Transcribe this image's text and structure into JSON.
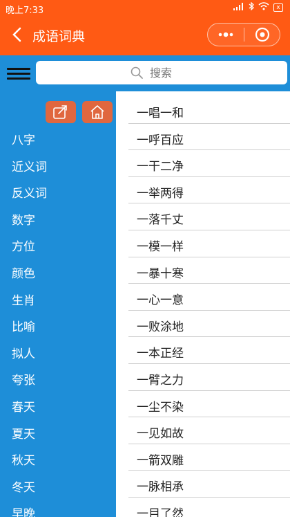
{
  "status": {
    "time": "晚上7:33",
    "battery": "x"
  },
  "nav": {
    "title": "成语词典"
  },
  "search": {
    "placeholder": "搜索"
  },
  "sidebar": {
    "categories": [
      "八字",
      "近义词",
      "反义词",
      "数字",
      "方位",
      "颜色",
      "生肖",
      "比喻",
      "拟人",
      "夸张",
      "春天",
      "夏天",
      "秋天",
      "冬天",
      "早晚"
    ]
  },
  "idioms": [
    "一唱一和",
    "一呼百应",
    "一干二净",
    "一举两得",
    "一落千丈",
    "一模一样",
    "一暴十寒",
    "一心一意",
    "一败涂地",
    "一本正经",
    "一臂之力",
    "一尘不染",
    "一见如故",
    "一箭双雕",
    "一脉相承",
    "一目了然"
  ],
  "colors": {
    "topbar": "#ff5a14",
    "sidebar": "#1e8ed8",
    "tool_button": "#e0673f"
  }
}
